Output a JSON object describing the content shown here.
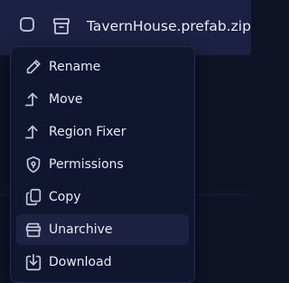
{
  "file_row": {
    "filename": "TavernHouse.prefab.zip",
    "icon": "archive-box-icon",
    "checked": false
  },
  "context_menu": {
    "items": [
      {
        "label": "Rename",
        "icon": "pencil-icon",
        "active": false
      },
      {
        "label": "Move",
        "icon": "arrow-up-icon",
        "active": false
      },
      {
        "label": "Region Fixer",
        "icon": "arrow-up-icon",
        "active": false
      },
      {
        "label": "Permissions",
        "icon": "shield-icon",
        "active": false
      },
      {
        "label": "Copy",
        "icon": "copy-icon",
        "active": false
      },
      {
        "label": "Unarchive",
        "icon": "unarchive-icon",
        "active": true
      },
      {
        "label": "Download",
        "icon": "download-icon",
        "active": false
      }
    ]
  },
  "colors": {
    "background": "#0f1326",
    "row_background": "#1c2143",
    "menu_background": "#111630",
    "active_item": "#1d2242",
    "text": "#e9ebf5",
    "icon": "#c5c9dc"
  }
}
